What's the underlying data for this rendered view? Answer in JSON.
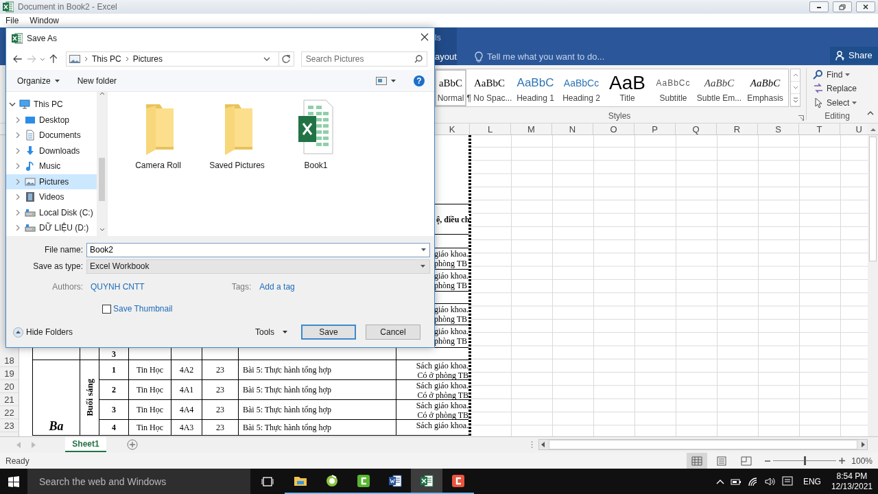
{
  "window": {
    "title": "Document in Book2 - Excel"
  },
  "menu": [
    {
      "label": "File"
    },
    {
      "label": "Window"
    }
  ],
  "ribbon": {
    "contextual_header": "ls",
    "tab": "ayout",
    "tell_me": {
      "placeholder": "Tell me what you want to do..."
    },
    "share": "Share",
    "styles": {
      "label": "Styles",
      "items": [
        {
          "kind": "normal",
          "preview": "aBbC",
          "name": "Normal",
          "selected": true
        },
        {
          "kind": "no_spacing",
          "preview": "AaBbC",
          "name": "¶ No Spac...",
          "selected": false
        },
        {
          "kind": "heading1",
          "preview": "AaBbC",
          "name": "Heading 1",
          "selected": false
        },
        {
          "kind": "heading2",
          "preview": "AaBbCc",
          "name": "Heading 2",
          "selected": false
        },
        {
          "kind": "title",
          "preview": "AaB",
          "name": "Title",
          "selected": false
        },
        {
          "kind": "subtitle",
          "preview": "AaBbCc",
          "name": "Subtitle",
          "selected": false
        },
        {
          "kind": "subtle_emphasis",
          "preview": "AaBbC",
          "name": "Subtle Em...",
          "selected": false
        },
        {
          "kind": "emphasis",
          "preview": "AaBbC",
          "name": "Emphasis",
          "selected": false
        }
      ]
    },
    "editing": {
      "label": "Editing",
      "items": [
        {
          "kind": "find",
          "label": "Find",
          "dropdown": true
        },
        {
          "kind": "replace",
          "label": "Replace",
          "dropdown": false
        },
        {
          "kind": "select",
          "label": "Select",
          "dropdown": true
        }
      ]
    }
  },
  "sheet": {
    "columns": [
      "K",
      "L",
      "M",
      "N",
      "O",
      "P",
      "Q",
      "R",
      "S",
      "T",
      "U"
    ],
    "upper_notes": [
      {
        "kind": "blank"
      },
      {
        "kind": "bold",
        "lines": [
          "ệ, điều ch"
        ]
      },
      {
        "kind": "blank"
      },
      {
        "kind": "plain",
        "lines": [
          "giáo khoa.",
          "phòng TB"
        ]
      },
      {
        "kind": "plain",
        "lines": [
          "giáo khoa.",
          "phòng TB"
        ]
      },
      {
        "kind": "blank"
      },
      {
        "kind": "plain",
        "lines": [
          "giáo khoa.",
          "phòng TB"
        ]
      },
      {
        "kind": "plain",
        "lines": [
          "giáo khoa.",
          "phòng TB"
        ]
      }
    ],
    "row_numbers": [
      "18",
      "19",
      "20",
      "21",
      "22",
      "23"
    ],
    "partial_row": {
      "number": "3"
    },
    "day": "Ba",
    "session": "Buổi sáng",
    "rows": [
      {
        "number": "1",
        "subject": "Tin Học",
        "class": "4A2",
        "period": "23",
        "lesson": "Bài 5: Thực hành tổng hợp",
        "notes": [
          "Sách giáo khoa.",
          "Có ở phòng TB"
        ]
      },
      {
        "number": "2",
        "subject": "Tin Học",
        "class": "4A1",
        "period": "23",
        "lesson": "Bài 5: Thực hành tổng hợp",
        "notes": [
          "Sách giáo khoa.",
          "Có ở phòng TB"
        ]
      },
      {
        "number": "3",
        "subject": "Tin Học",
        "class": "4A4",
        "period": "23",
        "lesson": "Bài 5: Thực hành tổng hợp",
        "notes": [
          "Sách giáo khoa.",
          "Có ở phòng TB"
        ]
      },
      {
        "number": "4",
        "subject": "Tin Học",
        "class": "4A3",
        "period": "23",
        "lesson": "Bài 5: Thực hành tổng hợp",
        "notes": [
          "Sách giáo khoa."
        ]
      }
    ]
  },
  "sheet_tabs": [
    {
      "label": "Sheet1",
      "selected": true
    }
  ],
  "status": {
    "text": "Ready",
    "views": [
      {
        "kind": "normal",
        "selected": true
      },
      {
        "kind": "page_layout",
        "selected": false
      },
      {
        "kind": "page_break",
        "selected": false
      }
    ],
    "zoom": {
      "level": 0.5,
      "reading": "100%"
    }
  },
  "dialog": {
    "title": "Save As",
    "breadcrumb": [
      "This PC",
      "Pictures"
    ],
    "search": {
      "placeholder": "Search Pictures"
    },
    "toolbar": {
      "organize": "Organize",
      "new_folder": "New folder",
      "help": "?"
    },
    "tree": [
      {
        "kind": "pc",
        "label": "This PC",
        "expanded": true,
        "selected": false,
        "children": [
          {
            "kind": "desktop",
            "label": "Desktop",
            "expanded": false,
            "selected": false
          },
          {
            "kind": "documents",
            "label": "Documents",
            "expanded": false,
            "selected": false
          },
          {
            "kind": "downloads",
            "label": "Downloads",
            "expanded": false,
            "selected": false
          },
          {
            "kind": "music",
            "label": "Music",
            "expanded": false,
            "selected": false
          },
          {
            "kind": "pictures",
            "label": "Pictures",
            "expanded": false,
            "selected": true
          },
          {
            "kind": "videos",
            "label": "Videos",
            "expanded": false,
            "selected": false
          },
          {
            "kind": "disk",
            "label": "Local Disk (C:)",
            "expanded": false,
            "selected": false
          },
          {
            "kind": "disk",
            "label": "DỮ LIỆU (D:)",
            "expanded": false,
            "selected": false
          }
        ]
      }
    ],
    "files": [
      {
        "kind": "folder",
        "name": "Camera Roll"
      },
      {
        "kind": "folder",
        "name": "Saved Pictures"
      },
      {
        "kind": "excel",
        "name": "Book1"
      }
    ],
    "file_name": {
      "label": "File name:",
      "value": "Book2"
    },
    "save_as_type": {
      "label": "Save as type:",
      "value": "Excel Workbook"
    },
    "authors": {
      "label": "Authors:",
      "value": "QUYNH CNTT"
    },
    "tags": {
      "label": "Tags:",
      "value": "Add a tag"
    },
    "save_thumbnail": {
      "label": "Save Thumbnail",
      "checked": false
    },
    "hide_folders": "Hide Folders",
    "tools": "Tools",
    "buttons": [
      {
        "kind": "primary",
        "label": "Save"
      },
      {
        "kind": "default",
        "label": "Cancel"
      }
    ]
  },
  "taskbar": {
    "search": {
      "placeholder": "Search the web and Windows"
    },
    "apps": [
      {
        "kind": "file_explorer",
        "running": true,
        "active": false
      },
      {
        "kind": "recorder",
        "running": true,
        "active": false
      },
      {
        "kind": "camtasia",
        "running": true,
        "active": false
      },
      {
        "kind": "word",
        "running": true,
        "active": false
      },
      {
        "kind": "excel",
        "running": true,
        "active": true
      },
      {
        "kind": "camtasia_red",
        "running": true,
        "active": false
      }
    ],
    "tray": {
      "language": "ENG",
      "time": "8:54 PM",
      "date": "12/13/2021"
    }
  }
}
